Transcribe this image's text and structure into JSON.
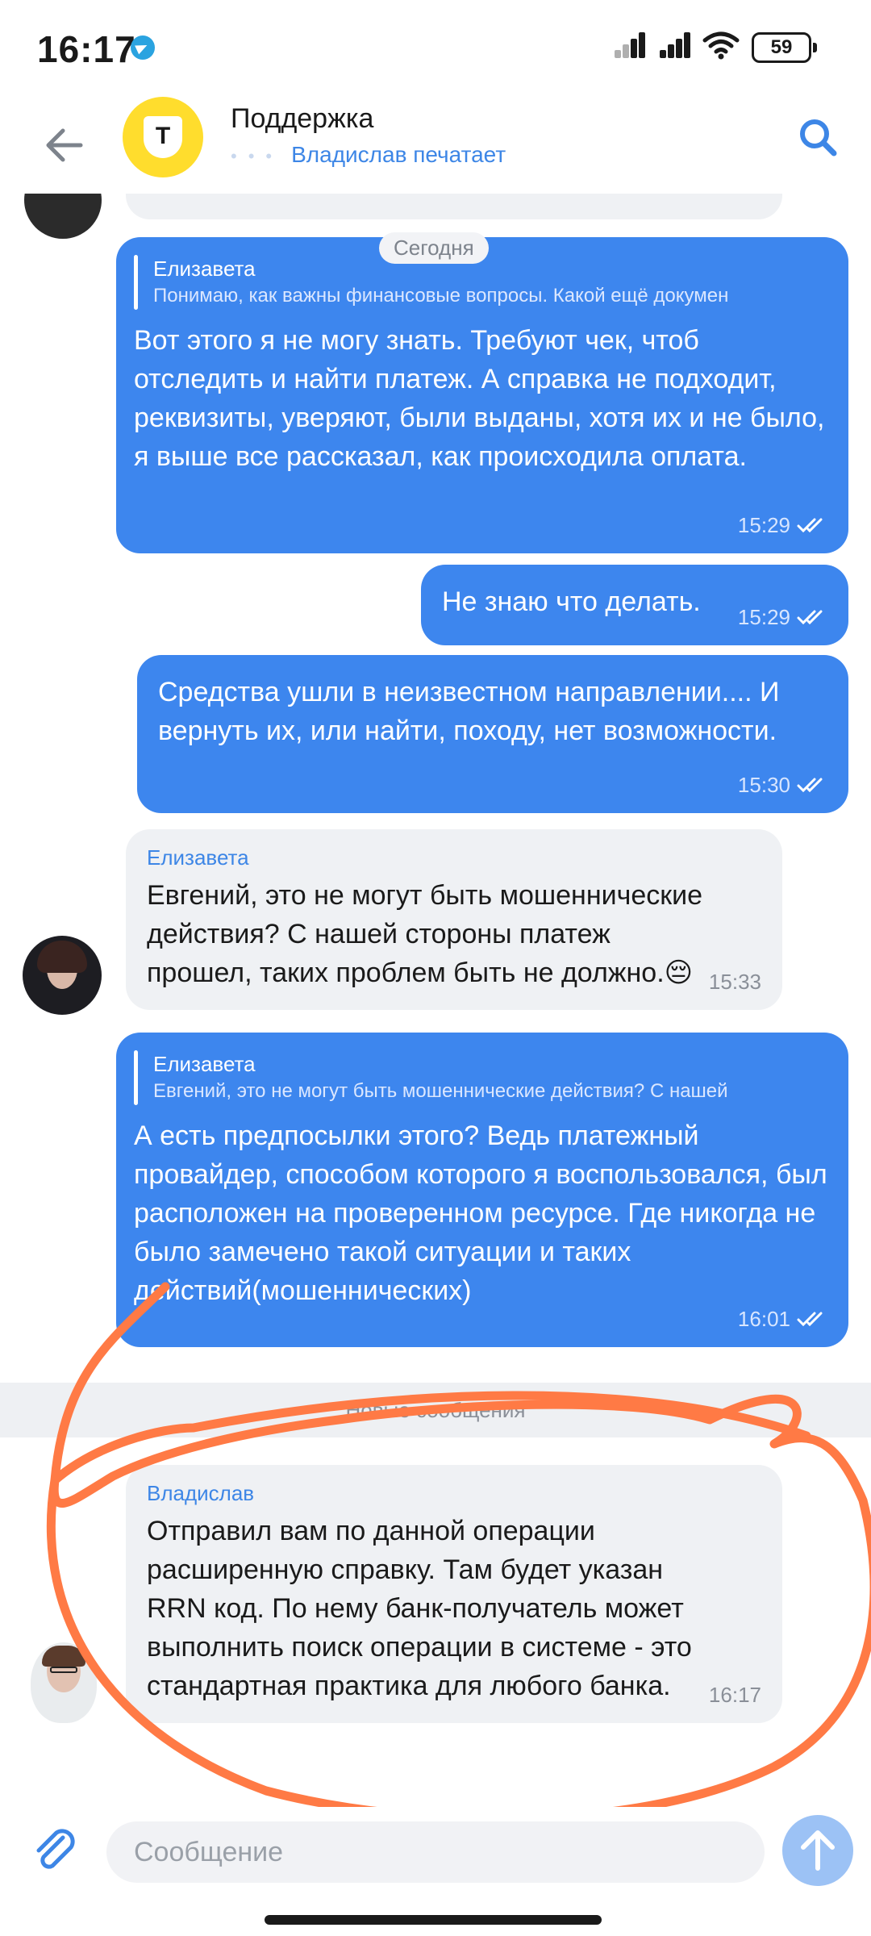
{
  "status": {
    "time": "16:17",
    "battery": "59"
  },
  "header": {
    "title": "Поддержка",
    "subtitle": "Владислав печатает"
  },
  "date_divider": "Сегодня",
  "messages": [
    {
      "quote_name": "Елизавета",
      "quote_text": "Понимаю, как важны финансовые вопросы. Какой ещё докумен",
      "text": "Вот этого я не могу знать. Требуют чек, чтоб отследить и найти платеж. А справка не подходит, реквизиты, уверяют, были выданы, хотя их и не было, я выше все рассказал, как происходила оплата.",
      "time": "15:29"
    },
    {
      "text": "Не знаю что делать.",
      "time": "15:29"
    },
    {
      "text": "Средства ушли в неизвестном направлении.... И вернуть их, или найти, походу, нет возможности.",
      "time": "15:30"
    },
    {
      "sender": "Елизавета",
      "text": "Евгений, это не могут быть мошеннические действия? С нашей стороны платеж прошел, таких проблем быть не должно.😔",
      "time": "15:33"
    },
    {
      "quote_name": "Елизавета",
      "quote_text": "Евгений, это не могут быть мошеннические действия? С нашей",
      "text": "А есть предпосылки этого? Ведь платежный провайдер, способом которого я воспользовался, был расположен на проверенном ресурсе. Где никогда не было замечено такой ситуации и таких действий(мошеннических)",
      "time": "16:01"
    },
    {
      "sender": "Владислав",
      "text": "Отправил вам по данной операции расширенную справку. Там будет указан RRN код. По нему банк-получатель может выполнить поиск операции в системе - это стандартная практика для любого банка.",
      "time": "16:17"
    }
  ],
  "new_messages_label": "Новые сообщения",
  "input": {
    "placeholder": "Сообщение"
  },
  "colors": {
    "outgoing": "#3d86ee",
    "incoming": "#eff1f4",
    "accent": "#3d86e6",
    "annotation": "#ff7a45",
    "brand": "#FFDD2D"
  }
}
